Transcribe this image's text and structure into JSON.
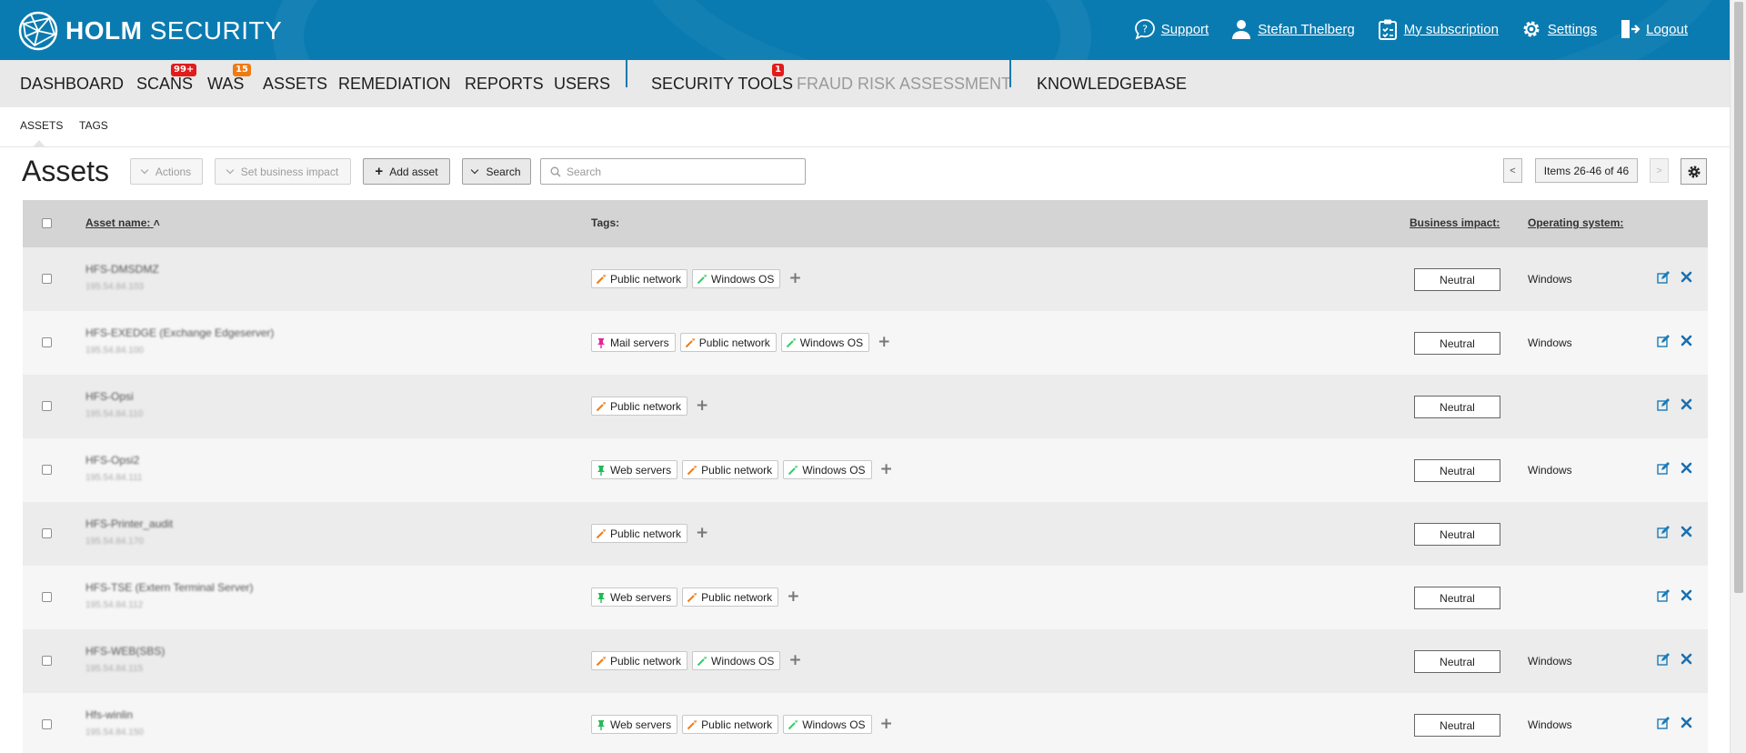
{
  "brand": {
    "name_bold": "HOLM",
    "name_light": "SECURITY"
  },
  "toplinks": [
    {
      "label": "Support",
      "icon": "help-chat-icon"
    },
    {
      "label": "Stefan Thelberg",
      "icon": "user-icon"
    },
    {
      "label": "My subscription",
      "icon": "clipboard-icon"
    },
    {
      "label": "Settings",
      "icon": "gear-icon"
    },
    {
      "label": "Logout",
      "icon": "logout-icon"
    }
  ],
  "nav": {
    "dashboard": "DASHBOARD",
    "scans": "SCANS",
    "scans_badge": "99+",
    "was": "WAS",
    "was_badge": "15",
    "assets": "ASSETS",
    "remediation": "REMEDIATION",
    "reports": "REPORTS",
    "users": "USERS",
    "security_tools": "SECURITY TOOLS",
    "security_tools_badge": "1",
    "fraud": "FRAUD RISK ASSESSMENT",
    "knowledgebase": "KNOWLEDGEBASE"
  },
  "subnav": {
    "assets": "ASSETS",
    "tags": "TAGS"
  },
  "toolbar": {
    "title": "Assets",
    "actions": "Actions",
    "set_impact": "Set business impact",
    "add_asset": "Add asset",
    "search_btn": "Search",
    "search_placeholder": "Search",
    "prev": "<",
    "next": ">",
    "pager": "Items 26-46 of 46"
  },
  "columns": {
    "asset_name": "Asset name:",
    "tags": "Tags:",
    "impact": "Business impact:",
    "os": "Operating system:"
  },
  "colors": {
    "header_blue": "#0a7bb0",
    "tag_public_network": "#f07a12",
    "tag_windows_os": "#33cc66",
    "tag_mail_servers": "#e0279a",
    "tag_web_servers": "#22bb55"
  },
  "rows": [
    {
      "name": "HFS-DMSDMZ",
      "ip": "195.54.84.103",
      "tags": [
        "Public network",
        "Windows OS"
      ],
      "impact": "Neutral",
      "os": "Windows"
    },
    {
      "name": "HFS-EXEDGE (Exchange Edgeserver)",
      "ip": "195.54.84.100",
      "tags": [
        "Mail servers",
        "Public network",
        "Windows OS"
      ],
      "impact": "Neutral",
      "os": "Windows"
    },
    {
      "name": "HFS-Opsi",
      "ip": "195.54.84.110",
      "tags": [
        "Public network"
      ],
      "impact": "Neutral",
      "os": ""
    },
    {
      "name": "HFS-Opsi2",
      "ip": "195.54.84.111",
      "tags": [
        "Web servers",
        "Public network",
        "Windows OS"
      ],
      "impact": "Neutral",
      "os": "Windows"
    },
    {
      "name": "HFS-Printer_audit",
      "ip": "195.54.84.170",
      "tags": [
        "Public network"
      ],
      "impact": "Neutral",
      "os": ""
    },
    {
      "name": "HFS-TSE (Extern Terminal Server)",
      "ip": "195.54.84.112",
      "tags": [
        "Web servers",
        "Public network"
      ],
      "impact": "Neutral",
      "os": ""
    },
    {
      "name": "HFS-WEB(SBS)",
      "ip": "195.54.84.115",
      "tags": [
        "Public network",
        "Windows OS"
      ],
      "impact": "Neutral",
      "os": "Windows"
    },
    {
      "name": "Hfs-winlin",
      "ip": "195.54.84.150",
      "tags": [
        "Web servers",
        "Public network",
        "Windows OS"
      ],
      "impact": "Neutral",
      "os": "Windows"
    }
  ]
}
